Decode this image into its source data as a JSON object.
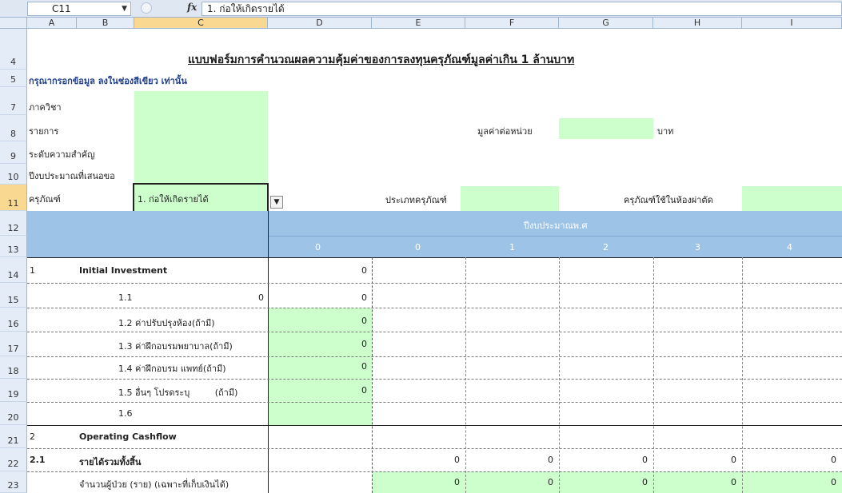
{
  "formula_bar": {
    "name_box": "C11",
    "fx_label": "fx",
    "formula": "1. ก่อให้เกิดรายได้"
  },
  "columns": [
    "A",
    "B",
    "C",
    "D",
    "E",
    "F",
    "G",
    "H",
    "I"
  ],
  "rows": [
    "4",
    "5",
    "7",
    "8",
    "9",
    "10",
    "11",
    "12",
    "13",
    "14",
    "15",
    "16",
    "17",
    "18",
    "19",
    "20",
    "21",
    "22",
    "23"
  ],
  "sheet": {
    "title": "แบบฟอร์มการคำนวณผลความคุ้มค่าของการลงทุนครุภัณฑ์มูลค่าเกิน 1 ล้านบาท",
    "instruction": "กรุณากรอกข้อมูล ลงในช่องสีเขียว เท่านั้น",
    "label_department": "ภาควิชา",
    "label_item": "รายการ",
    "label_priority": "ระดับความสำคัญ",
    "label_budget_year": "ปีงบประมาณที่เสนอขอ",
    "label_equipment": "ครุภัณฑ์",
    "equipment_value": "1. ก่อให้เกิดรายได้",
    "label_unit_price": "มูลค่าต่อหน่วย",
    "label_baht": "บาท",
    "label_equipment_type": "ประเภทครุภัณฑ์",
    "label_equipment_used": "ครุภัณฑ์ใช้ในห้องผ่าตัด",
    "header_year": "ปีงบประมาณพ.ศ",
    "year_cols": [
      "0",
      "0",
      "1",
      "2",
      "3",
      "4"
    ],
    "r14_no": "1",
    "r14_label": "Initial Investment",
    "r14_d": "0",
    "r15_label": "1.1",
    "r15_c": "0",
    "r15_d": "0",
    "r16_label": "1.2 ค่าปรับปรุงห้อง(ถ้ามี)",
    "r16_d": "0",
    "r17_label": "1.3 ค่าฝึกอบรมพยาบาล(ถ้ามี)",
    "r17_d": "0",
    "r18_label": "1.4 ค่าฝึกอบรม แพทย์(ถ้ามี)",
    "r18_d": "0",
    "r19_label": "1.5 อื่นๆ โปรดระบุ         (ถ้ามี)",
    "r19_d": "0",
    "r20_label": "1.6",
    "r21_no": "2",
    "r21_label": "Operating Cashflow",
    "r22_no": "2.1",
    "r22_label": "รายได้รวมทั้งสิ้น",
    "r22_vals": [
      "0",
      "0",
      "0",
      "0",
      "0"
    ],
    "r23_label": "จำนวนผู้ป่วย (ราย) (เฉพาะที่เก็บเงินได้)",
    "r23_vals": [
      "0",
      "0",
      "0",
      "0",
      "0"
    ]
  }
}
